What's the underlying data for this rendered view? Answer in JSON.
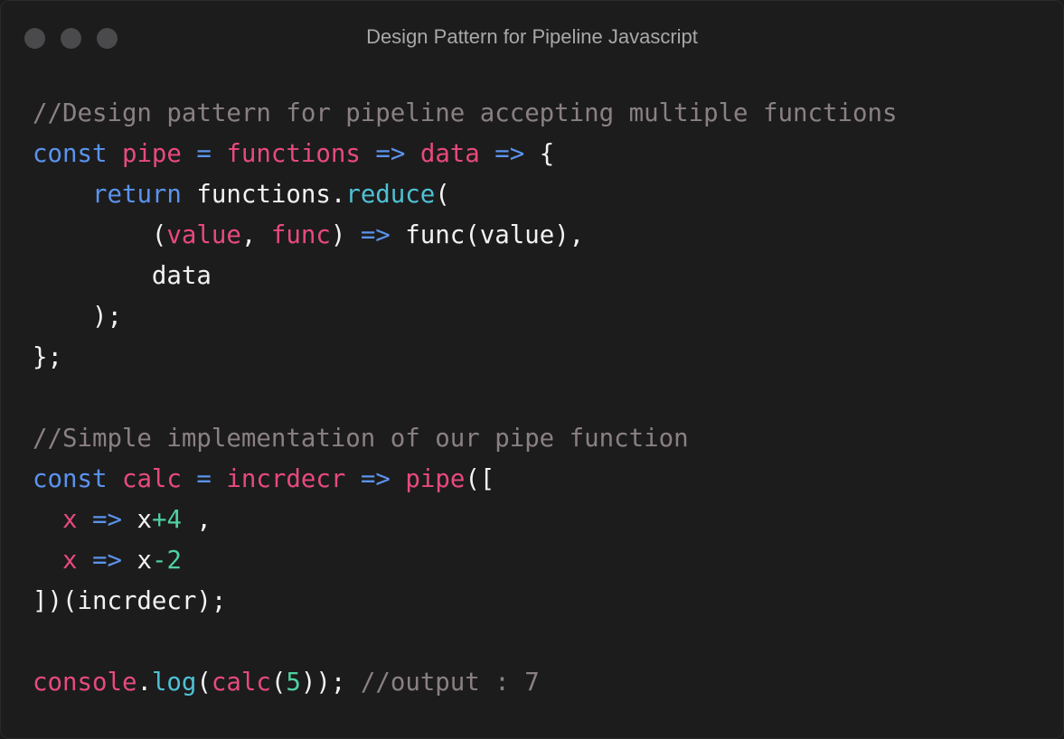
{
  "window": {
    "title": "Design Pattern for Pipeline Javascript",
    "controls": [
      "close",
      "minimize",
      "maximize"
    ]
  },
  "colors": {
    "background": "#1c1c1d",
    "comment": "#8a8082",
    "keyword": "#5b93ec",
    "variable": "#e84a7c",
    "method": "#4fc1d4",
    "number": "#4fd1a0",
    "text": "#f2f2f2"
  },
  "code": {
    "lines": [
      [
        {
          "t": "comment",
          "s": "//Design pattern for pipeline accepting multiple functions"
        }
      ],
      [
        {
          "t": "keyword",
          "s": "const"
        },
        {
          "t": "plain",
          "s": " "
        },
        {
          "t": "var",
          "s": "pipe"
        },
        {
          "t": "plain",
          "s": " "
        },
        {
          "t": "op",
          "s": "="
        },
        {
          "t": "plain",
          "s": " "
        },
        {
          "t": "var",
          "s": "functions"
        },
        {
          "t": "plain",
          "s": " "
        },
        {
          "t": "op",
          "s": "=>"
        },
        {
          "t": "plain",
          "s": " "
        },
        {
          "t": "var",
          "s": "data"
        },
        {
          "t": "plain",
          "s": " "
        },
        {
          "t": "op",
          "s": "=>"
        },
        {
          "t": "plain",
          "s": " {"
        }
      ],
      [
        {
          "t": "plain",
          "s": "    "
        },
        {
          "t": "keyword",
          "s": "return"
        },
        {
          "t": "plain",
          "s": " functions."
        },
        {
          "t": "method",
          "s": "reduce"
        },
        {
          "t": "plain",
          "s": "("
        }
      ],
      [
        {
          "t": "plain",
          "s": "        ("
        },
        {
          "t": "var",
          "s": "value"
        },
        {
          "t": "plain",
          "s": ", "
        },
        {
          "t": "var",
          "s": "func"
        },
        {
          "t": "plain",
          "s": ") "
        },
        {
          "t": "op",
          "s": "=>"
        },
        {
          "t": "plain",
          "s": " func(value),"
        }
      ],
      [
        {
          "t": "plain",
          "s": "        data"
        }
      ],
      [
        {
          "t": "plain",
          "s": "    );"
        }
      ],
      [
        {
          "t": "plain",
          "s": "};"
        }
      ],
      [],
      [
        {
          "t": "comment",
          "s": "//Simple implementation of our pipe function"
        }
      ],
      [
        {
          "t": "keyword",
          "s": "const"
        },
        {
          "t": "plain",
          "s": " "
        },
        {
          "t": "var",
          "s": "calc"
        },
        {
          "t": "plain",
          "s": " "
        },
        {
          "t": "op",
          "s": "="
        },
        {
          "t": "plain",
          "s": " "
        },
        {
          "t": "var",
          "s": "incrdecr"
        },
        {
          "t": "plain",
          "s": " "
        },
        {
          "t": "op",
          "s": "=>"
        },
        {
          "t": "plain",
          "s": " "
        },
        {
          "t": "var",
          "s": "pipe"
        },
        {
          "t": "plain",
          "s": "(["
        }
      ],
      [
        {
          "t": "plain",
          "s": "  "
        },
        {
          "t": "var",
          "s": "x"
        },
        {
          "t": "plain",
          "s": " "
        },
        {
          "t": "op",
          "s": "=>"
        },
        {
          "t": "plain",
          "s": " x"
        },
        {
          "t": "number",
          "s": "+4"
        },
        {
          "t": "plain",
          "s": " ,"
        }
      ],
      [
        {
          "t": "plain",
          "s": "  "
        },
        {
          "t": "var",
          "s": "x"
        },
        {
          "t": "plain",
          "s": " "
        },
        {
          "t": "op",
          "s": "=>"
        },
        {
          "t": "plain",
          "s": " x"
        },
        {
          "t": "number",
          "s": "-2"
        }
      ],
      [
        {
          "t": "plain",
          "s": "])(incrdecr);"
        }
      ],
      [],
      [
        {
          "t": "var",
          "s": "console"
        },
        {
          "t": "plain",
          "s": "."
        },
        {
          "t": "method",
          "s": "log"
        },
        {
          "t": "plain",
          "s": "("
        },
        {
          "t": "var",
          "s": "calc"
        },
        {
          "t": "plain",
          "s": "("
        },
        {
          "t": "number",
          "s": "5"
        },
        {
          "t": "plain",
          "s": ")); "
        },
        {
          "t": "comment",
          "s": "//output : 7"
        }
      ]
    ]
  }
}
